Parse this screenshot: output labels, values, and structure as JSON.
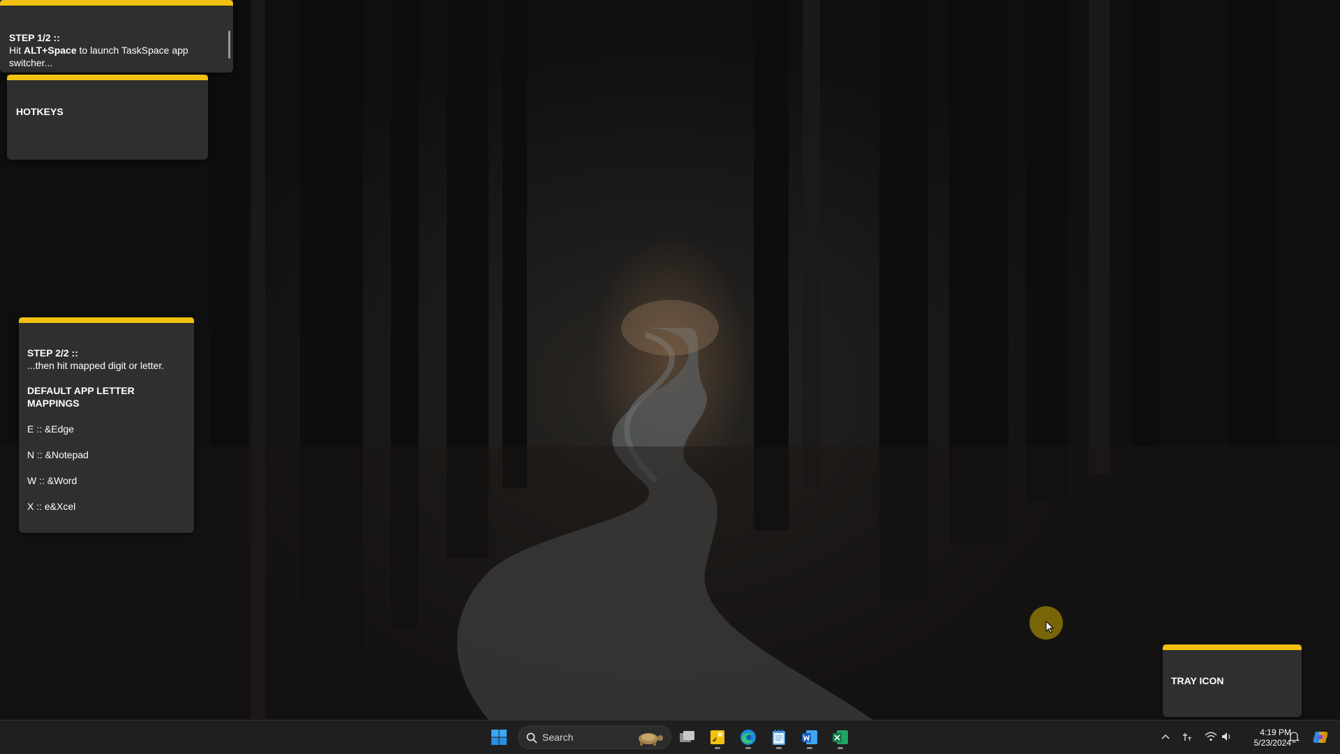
{
  "cards": {
    "step1": {
      "title": "STEP 1/2 ::",
      "pre": "Hit ",
      "hotkey": "ALT+Space",
      "post": " to launch TaskSpace app switcher..."
    },
    "hotkeys": {
      "title": "HOTKEYS"
    },
    "step2": {
      "title": "STEP 2/2 ::",
      "subtitle": "...then hit mapped digit or letter.",
      "mappings_title": "DEFAULT APP LETTER MAPPINGS",
      "mappings": [
        "E :: &Edge",
        "N :: &Notepad",
        "W :: &Word",
        "X :: e&Xcel"
      ]
    },
    "tray": {
      "title": "TRAY ICON"
    }
  },
  "taskbar": {
    "search_label": "Search",
    "apps": [
      {
        "name": "start",
        "icon": "windows-logo-icon"
      },
      {
        "name": "task-view",
        "icon": "task-view-icon"
      },
      {
        "name": "taskspace",
        "icon": "taskspace-icon",
        "running": true
      },
      {
        "name": "edge",
        "icon": "edge-icon",
        "running": true
      },
      {
        "name": "notepad",
        "icon": "notepad-icon",
        "running": true
      },
      {
        "name": "word",
        "icon": "word-icon",
        "running": true
      },
      {
        "name": "excel",
        "icon": "excel-icon",
        "running": true
      }
    ],
    "time": "4:19 PM",
    "date": "5/23/2024"
  },
  "colors": {
    "accent": "#f2c10f",
    "card_bg": "#2f2f2f",
    "taskbar_bg": "#1f1f1f",
    "cursor_halo": "#c8aa00"
  }
}
